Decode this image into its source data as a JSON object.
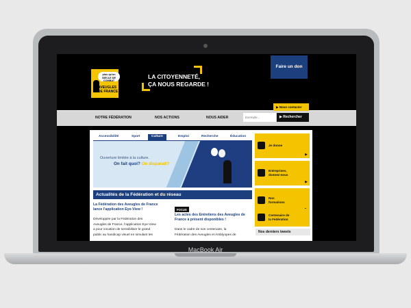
{
  "laptop": {
    "brand": "MacBook Air"
  },
  "header": {
    "logo": {
      "badge": "plus qu'un SIECLE DE COMBAT",
      "name_line1": "AVEUGLES",
      "name_line2": "DE FRANCE"
    },
    "tagline_line1": "LA CITOYENNETÉ,",
    "tagline_line2": "ÇA NOUS REGARDE !",
    "donate_label": "Faire un don",
    "contact_label": "Nous contacter"
  },
  "nav": {
    "items": [
      {
        "label": "NOTRE FÉDÉRATION"
      },
      {
        "label": "NOS ACTIONS"
      },
      {
        "label": "NOUS AIDER"
      }
    ],
    "search": {
      "placeholder": "Exemple...",
      "button_label": "Rechercher"
    }
  },
  "tabs": [
    {
      "label": "Accessibilité"
    },
    {
      "label": "Sport"
    },
    {
      "label": "Culture",
      "active": true
    },
    {
      "label": "Emploi"
    },
    {
      "label": "Recherche"
    },
    {
      "label": "Éducation"
    }
  ],
  "banner": {
    "line1": "Ouverture limitée à la culture.",
    "line2_a": "On fait quoi?",
    "line2_b": "On disparaît?"
  },
  "news": {
    "section_title": "Actualités de la Fédération et du réseau",
    "article1": {
      "title_line1": "La Fédération des Aveugles de France",
      "title_line2": "lance l'application Eye-View !",
      "text_lines": [
        "Développée par la Fédération des",
        "Aveugles de France, l'application Eye-View",
        "a pour vocation de sensibiliser le grand",
        "public au handicap visuel en simulant les"
      ]
    },
    "article2": {
      "badge": "FOCUS",
      "title_line1": "Les actes des Entretiens des Aveugles de",
      "title_line2": "France à présent disponibles !",
      "text_lines": [
        "Dans le cadre de son centenaire, la",
        "Fédération des Aveugles et Amblyopes de"
      ]
    }
  },
  "sidebar": {
    "boxes": [
      {
        "line1": "Je donne",
        "line2": ""
      },
      {
        "line1": "Entreprises,",
        "line2": "donnez-nous"
      },
      {
        "line1": "Nos",
        "line2": "formations"
      },
      {
        "line1": "Centenaire de",
        "line2": "la Fédération"
      }
    ],
    "tweets_label": "Nos derniers tweets"
  },
  "colors": {
    "accent": "#f5c400",
    "brand_blue": "#1c3f7d",
    "header_bg": "#000000",
    "nav_bg": "#d7d7d7"
  }
}
